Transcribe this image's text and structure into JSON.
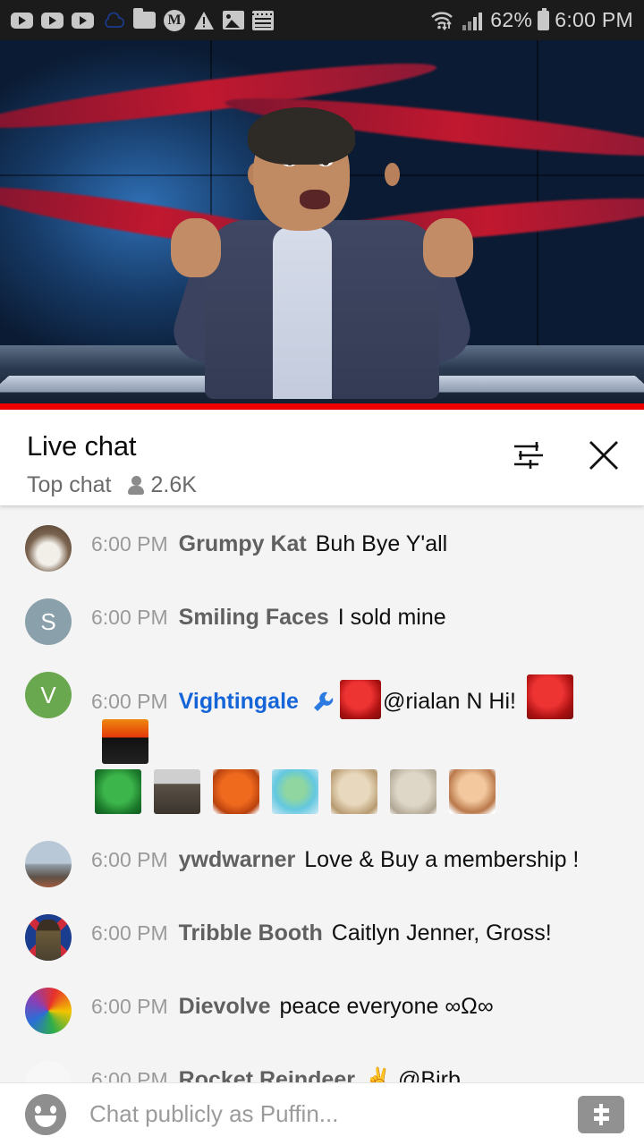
{
  "status_bar": {
    "icons": [
      "youtube-icon",
      "youtube-icon",
      "youtube-icon",
      "cloud-icon",
      "folder-icon",
      "m-circle-icon",
      "warning-icon",
      "image-icon",
      "notepad-icon"
    ],
    "wifi_icon": "wifi-updown-icon",
    "signal_icon": "cell-signal-icon",
    "battery_percent": "62%",
    "battery_icon": "battery-icon",
    "time": "6:00 PM"
  },
  "video": {
    "progress_color": "#ee0000",
    "description": "news-host-video-frame"
  },
  "chat_header": {
    "title": "Live chat",
    "mode": "Top chat",
    "viewers_icon": "person-icon",
    "viewers": "2.6K",
    "settings_icon": "tune-sliders-icon",
    "close_icon": "close-icon"
  },
  "messages": [
    {
      "time": "6:00 PM",
      "author": "Grumpy Kat",
      "author_color": "#606060",
      "is_moderator": false,
      "text": "Buh Bye Y'all",
      "avatar_type": "photo",
      "avatar_class": "av-grumpy",
      "avatar_letter": "",
      "badges": [],
      "inline_emotes": [],
      "emote_row": []
    },
    {
      "time": "6:00 PM",
      "author": "Smiling Faces",
      "author_color": "#606060",
      "is_moderator": false,
      "text": "I sold mine",
      "avatar_type": "letter",
      "avatar_class": "av-letter-s",
      "avatar_letter": "S",
      "badges": [],
      "inline_emotes": [],
      "emote_row": []
    },
    {
      "time": "6:00 PM",
      "author": "Vightingale",
      "author_color": "#1565d8",
      "is_moderator": true,
      "text": "@rialan N Hi!",
      "avatar_type": "letter",
      "avatar_class": "av-letter-v",
      "avatar_letter": "V",
      "badges": [
        "moderator-wrench-badge"
      ],
      "inline_emotes": [
        "red-dragon-emote"
      ],
      "trailing_emotes": [
        "red-dragon-head-emote",
        "flame-person-emote"
      ],
      "emote_row": [
        "green-dragon-emote",
        "bernie-sanders-emote",
        "red-panda-emote",
        "frog-emote",
        "chihuahua-emote",
        "fluffy-dog-emote",
        "monkey-doctor-emote"
      ]
    },
    {
      "time": "6:00 PM",
      "author": "ywdwarner",
      "author_color": "#606060",
      "is_moderator": false,
      "text": "Love & Buy a membership !",
      "avatar_type": "photo",
      "avatar_class": "av-sky",
      "avatar_letter": "",
      "badges": [],
      "inline_emotes": [],
      "emote_row": []
    },
    {
      "time": "6:00 PM",
      "author": "Tribble Booth",
      "author_color": "#606060",
      "is_moderator": false,
      "text": "Caitlyn Jenner, Gross!",
      "avatar_type": "photo",
      "avatar_class": "av-uk",
      "avatar_letter": "",
      "badges": [],
      "inline_emotes": [],
      "emote_row": []
    },
    {
      "time": "6:00 PM",
      "author": "Dievolve",
      "author_color": "#606060",
      "is_moderator": false,
      "text": "peace everyone ∞Ω∞",
      "avatar_type": "photo",
      "avatar_class": "av-tiedye",
      "avatar_letter": "",
      "badges": [],
      "inline_emotes": [],
      "emote_row": []
    },
    {
      "time": "6:00 PM",
      "author": "Rocket Reindeer",
      "author_color": "#606060",
      "is_moderator": false,
      "text": "✌ @Birb",
      "avatar_type": "photo",
      "avatar_class": "av-snow",
      "avatar_letter": "",
      "badges": [],
      "inline_emotes": [],
      "emote_row": []
    }
  ],
  "input_bar": {
    "emoji_icon": "emoji-smiley-icon",
    "placeholder": "Chat publicly as Puffin...",
    "superchat_icon": "dollar-superchat-icon"
  },
  "colors": {
    "chat_bg": "#f4f4f4",
    "moderator_blue": "#1565d8",
    "author_gray": "#606060",
    "time_gray": "#9a9a9a",
    "youtube_red": "#ee0000"
  }
}
